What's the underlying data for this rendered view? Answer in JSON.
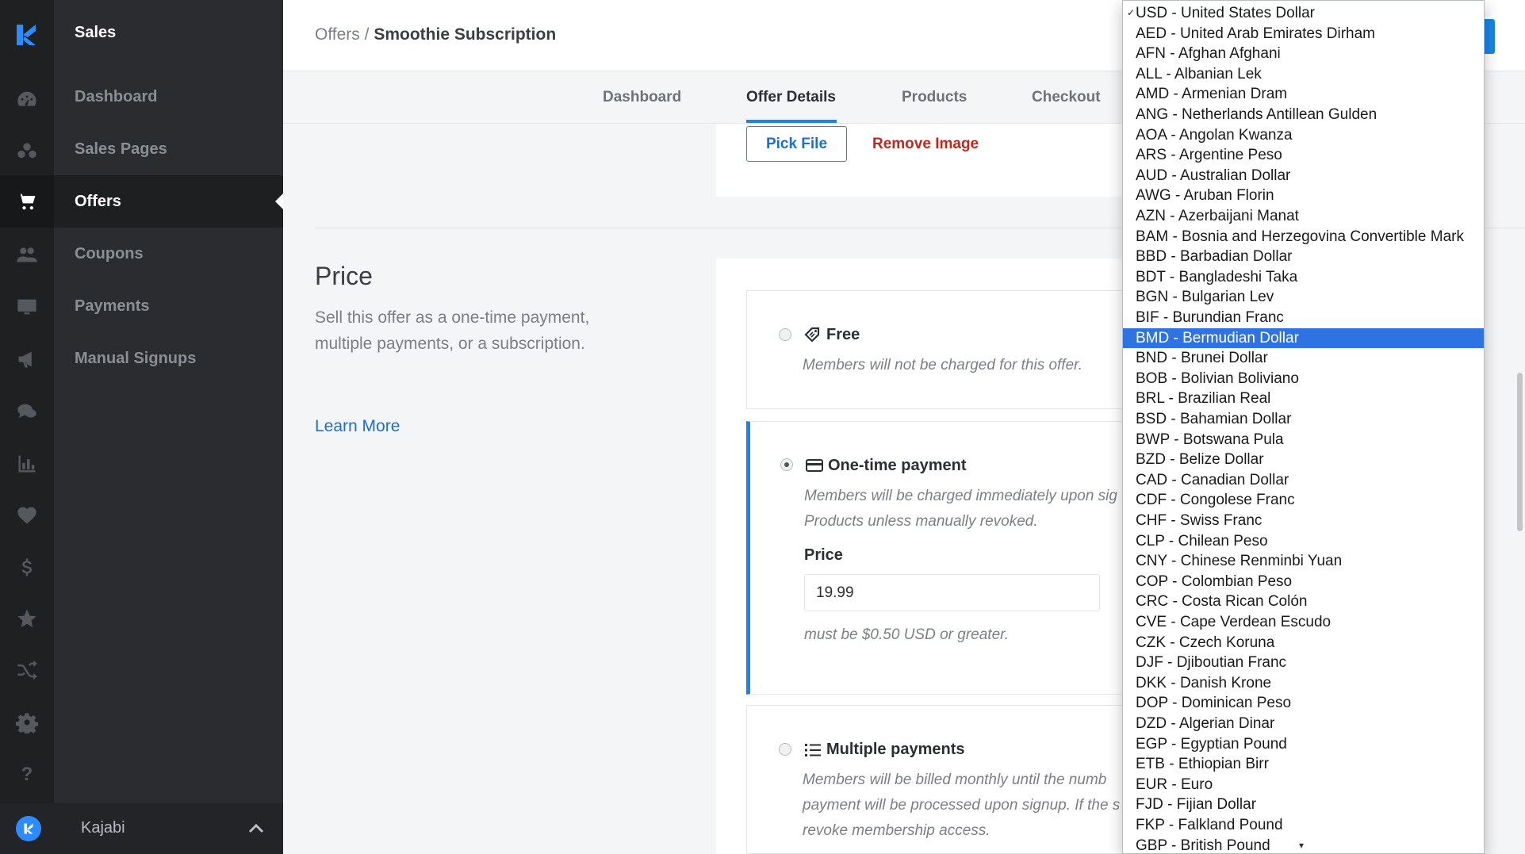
{
  "sidebar": {
    "title": "Sales",
    "items": [
      {
        "label": "Dashboard"
      },
      {
        "label": "Sales Pages"
      },
      {
        "label": "Offers"
      },
      {
        "label": "Coupons"
      },
      {
        "label": "Payments"
      },
      {
        "label": "Manual Signups"
      }
    ],
    "account_name": "Kajabi"
  },
  "header": {
    "breadcrumb_parent": "Offers",
    "breadcrumb_sep": "/",
    "breadcrumb_current": "Smoothie Subscription"
  },
  "tabs": [
    {
      "label": "Dashboard"
    },
    {
      "label": "Offer Details"
    },
    {
      "label": "Products"
    },
    {
      "label": "Checkout"
    }
  ],
  "image_section": {
    "pick_file": "Pick File",
    "remove_image": "Remove Image"
  },
  "price_section": {
    "title": "Price",
    "description": "Sell this offer as a one-time payment, multiple payments, or a subscription.",
    "learn_more": "Learn More",
    "options": {
      "free": {
        "title": "Free",
        "desc": "Members will not be charged for this offer."
      },
      "one_time": {
        "title": "One-time payment",
        "desc_1": "Members will be charged immediately upon sig",
        "desc_2": "Products unless manually revoked.",
        "price_label": "Price",
        "price_value": "19.99",
        "hint": "must be $0.50 USD or greater."
      },
      "multiple": {
        "title": "Multiple payments",
        "desc_1": "Members will be billed monthly until the numb",
        "desc_2": "payment will be processed upon signup. If the s",
        "desc_3": "revoke membership access."
      }
    }
  },
  "currency_dropdown": {
    "checked": "✓",
    "selected_highlight": "BMD - Bermudian Dollar",
    "options": [
      "USD - United States Dollar",
      "AED - United Arab Emirates Dirham",
      "AFN - Afghan Afghani",
      "ALL - Albanian Lek",
      "AMD - Armenian Dram",
      "ANG - Netherlands Antillean Gulden",
      "AOA - Angolan Kwanza",
      "ARS - Argentine Peso",
      "AUD - Australian Dollar",
      "AWG - Aruban Florin",
      "AZN - Azerbaijani Manat",
      "BAM - Bosnia and Herzegovina Convertible Mark",
      "BBD - Barbadian Dollar",
      "BDT - Bangladeshi Taka",
      "BGN - Bulgarian Lev",
      "BIF - Burundian Franc",
      "BMD - Bermudian Dollar",
      "BND - Brunei Dollar",
      "BOB - Bolivian Boliviano",
      "BRL - Brazilian Real",
      "BSD - Bahamian Dollar",
      "BWP - Botswana Pula",
      "BZD - Belize Dollar",
      "CAD - Canadian Dollar",
      "CDF - Congolese Franc",
      "CHF - Swiss Franc",
      "CLP - Chilean Peso",
      "CNY - Chinese Renminbi Yuan",
      "COP - Colombian Peso",
      "CRC - Costa Rican Colón",
      "CVE - Cape Verdean Escudo",
      "CZK - Czech Koruna",
      "DJF - Djiboutian Franc",
      "DKK - Danish Krone",
      "DOP - Dominican Peso",
      "DZD - Algerian Dinar",
      "EGP - Egyptian Pound",
      "ETB - Ethiopian Birr",
      "EUR - Euro",
      "FJD - Fijian Dollar",
      "FKP - Falkland Pound",
      "GBP - British Pound"
    ],
    "more_arrow": "▾"
  },
  "icons": {
    "rail": [
      "dashboard-icon",
      "sales-pages-icon",
      "cart-icon",
      "people-icon",
      "monitor-icon",
      "megaphone-icon",
      "chat-icon",
      "chart-icon",
      "heart-icon",
      "dollar-icon",
      "star-icon",
      "shuffle-icon",
      "gear-icon",
      "help-icon"
    ]
  },
  "colors": {
    "accent": "#1b84e7",
    "danger": "#c0281e",
    "highlight": "#2f72e2"
  }
}
